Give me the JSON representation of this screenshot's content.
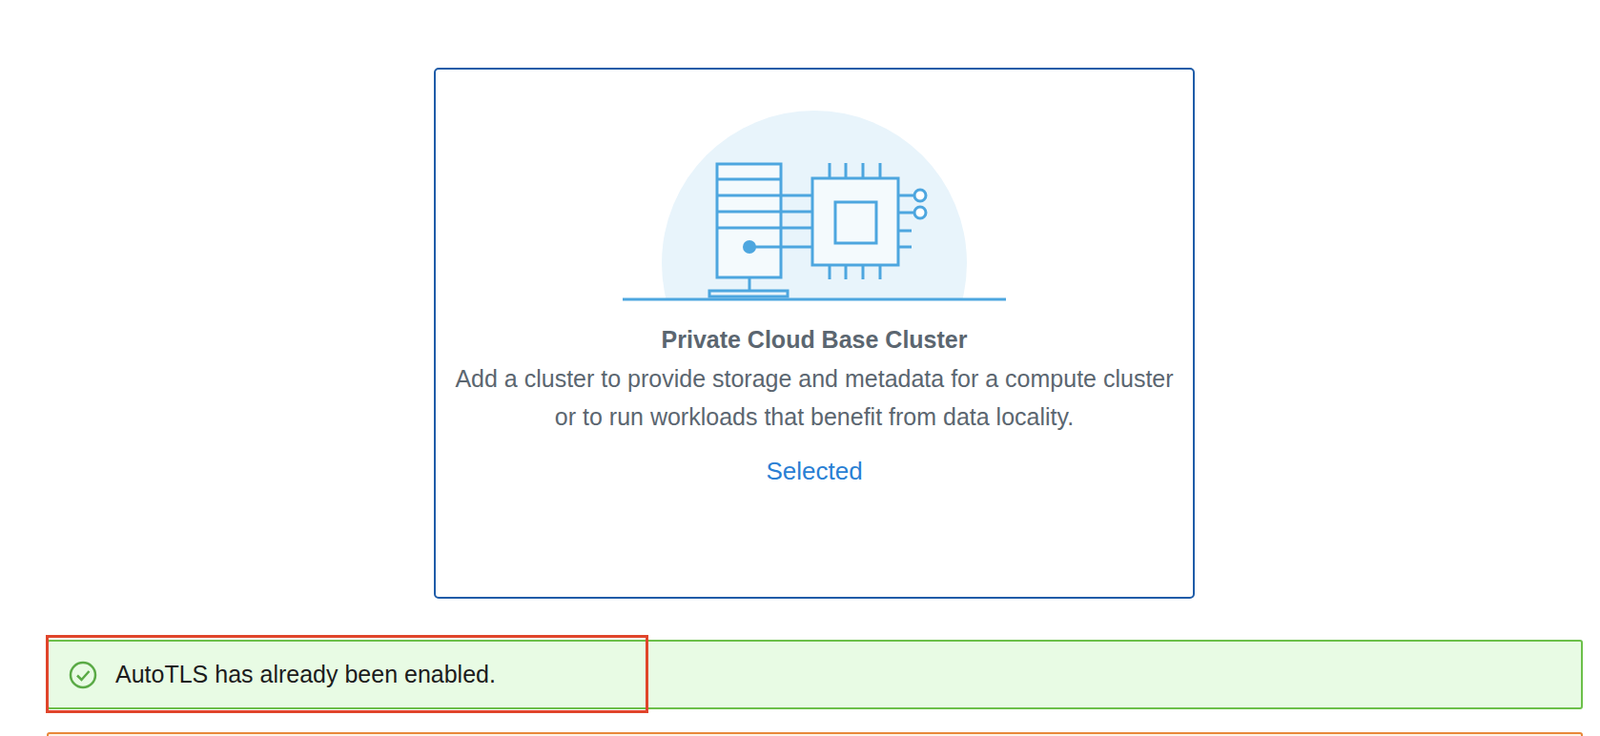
{
  "card": {
    "title": "Private Cloud Base Cluster",
    "description": "Add a cluster to provide storage and metadata for a compute cluster or to run workloads that benefit from data locality.",
    "action": "Selected",
    "selected": true
  },
  "banners": [
    {
      "text": "AutoTLS has already been enabled.",
      "kind": "success",
      "highlighted": true
    }
  ]
}
